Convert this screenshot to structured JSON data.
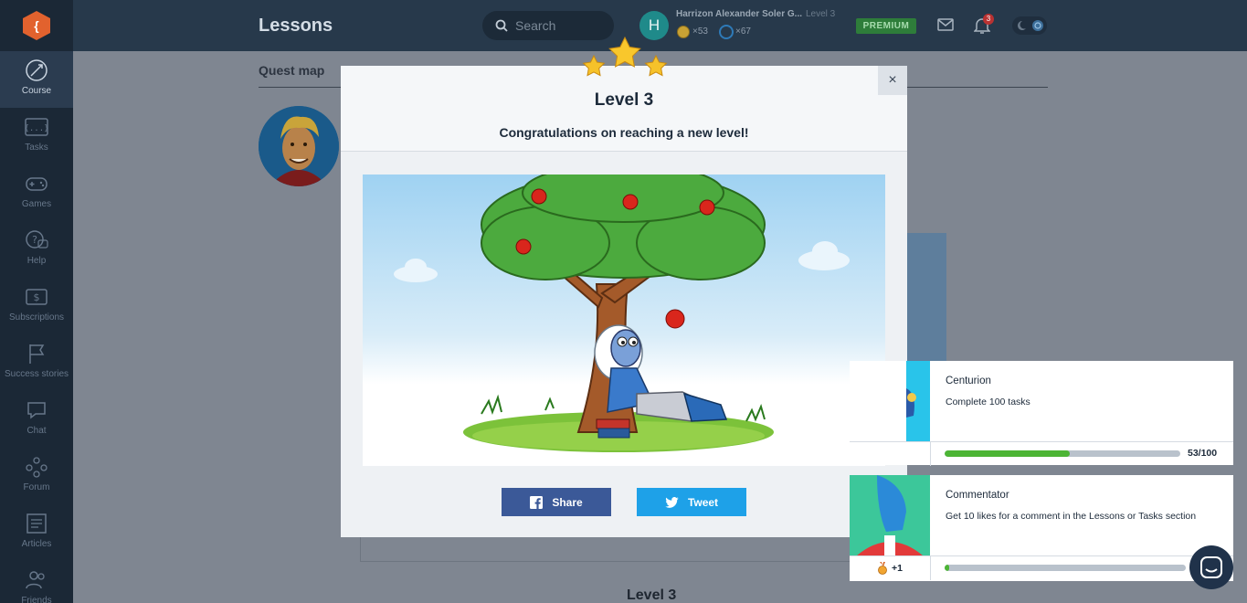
{
  "sidebar": {
    "items": [
      {
        "label": "Course",
        "icon": "rocket-icon",
        "active": true
      },
      {
        "label": "Tasks",
        "icon": "code-icon"
      },
      {
        "label": "Games",
        "icon": "gamepad-icon"
      },
      {
        "label": "Help",
        "icon": "help-icon"
      },
      {
        "label": "Subscriptions",
        "icon": "dollar-icon"
      },
      {
        "label": "Success stories",
        "icon": "flag-icon"
      },
      {
        "label": "Chat",
        "icon": "chat-icon"
      },
      {
        "label": "Forum",
        "icon": "forum-icon"
      },
      {
        "label": "Articles",
        "icon": "articles-icon"
      },
      {
        "label": "Friends",
        "icon": "friends-icon"
      }
    ]
  },
  "header": {
    "title": "Lessons",
    "search_placeholder": "Search",
    "user": {
      "initial": "H",
      "name": "Harrizon Alexander Soler G...",
      "level": "Level 3",
      "coins": "×53",
      "experience": "×67"
    },
    "premium_label": "PREMIUM",
    "notifications_count": "3"
  },
  "page": {
    "tab": "Quest map",
    "level_label": "Level 3"
  },
  "modal": {
    "level": "Level 3",
    "message": "Congratulations on reaching a new level!",
    "close_label": "×",
    "share_label": "Share",
    "tweet_label": "Tweet"
  },
  "achievements": [
    {
      "title": "Centurion",
      "description": "Complete 100 tasks",
      "progress": 0.53,
      "progress_label": "53/100"
    },
    {
      "title": "Commentator",
      "description": "Get 10 likes for a comment in the Lessons or Tasks section",
      "progress": 0.02,
      "reward": "+1"
    }
  ],
  "colors": {
    "sidebar_bg": "#1b2836",
    "topbar_bg": "#27394b",
    "premium": "#2e7d3a",
    "facebook": "#3b5998",
    "twitter": "#1ea1e8",
    "progress": "#4cb535"
  }
}
